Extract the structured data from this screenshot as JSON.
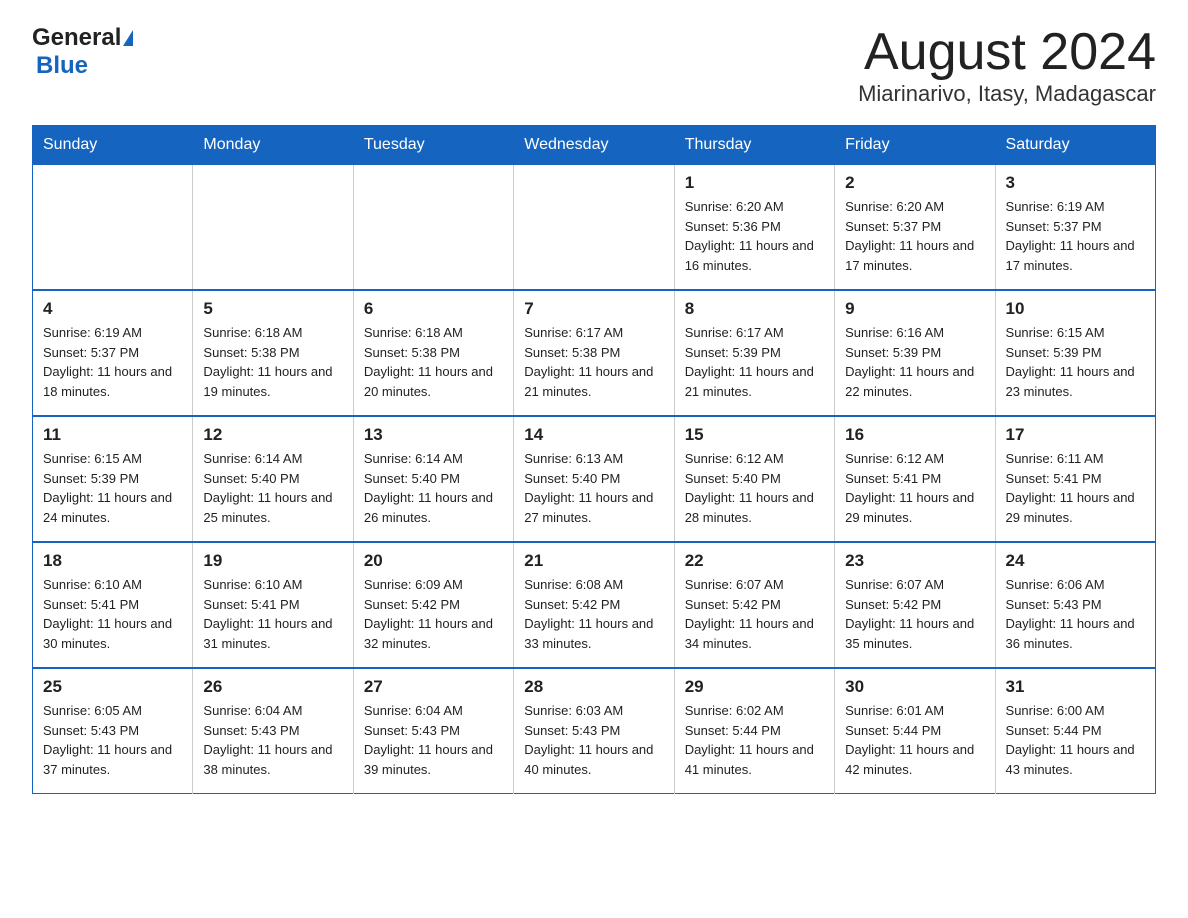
{
  "header": {
    "logo_general": "General",
    "logo_blue": "Blue",
    "month_title": "August 2024",
    "location": "Miarinarivo, Itasy, Madagascar"
  },
  "days_of_week": [
    "Sunday",
    "Monday",
    "Tuesday",
    "Wednesday",
    "Thursday",
    "Friday",
    "Saturday"
  ],
  "weeks": [
    [
      {
        "day": "",
        "info": ""
      },
      {
        "day": "",
        "info": ""
      },
      {
        "day": "",
        "info": ""
      },
      {
        "day": "",
        "info": ""
      },
      {
        "day": "1",
        "info": "Sunrise: 6:20 AM\nSunset: 5:36 PM\nDaylight: 11 hours and 16 minutes."
      },
      {
        "day": "2",
        "info": "Sunrise: 6:20 AM\nSunset: 5:37 PM\nDaylight: 11 hours and 17 minutes."
      },
      {
        "day": "3",
        "info": "Sunrise: 6:19 AM\nSunset: 5:37 PM\nDaylight: 11 hours and 17 minutes."
      }
    ],
    [
      {
        "day": "4",
        "info": "Sunrise: 6:19 AM\nSunset: 5:37 PM\nDaylight: 11 hours and 18 minutes."
      },
      {
        "day": "5",
        "info": "Sunrise: 6:18 AM\nSunset: 5:38 PM\nDaylight: 11 hours and 19 minutes."
      },
      {
        "day": "6",
        "info": "Sunrise: 6:18 AM\nSunset: 5:38 PM\nDaylight: 11 hours and 20 minutes."
      },
      {
        "day": "7",
        "info": "Sunrise: 6:17 AM\nSunset: 5:38 PM\nDaylight: 11 hours and 21 minutes."
      },
      {
        "day": "8",
        "info": "Sunrise: 6:17 AM\nSunset: 5:39 PM\nDaylight: 11 hours and 21 minutes."
      },
      {
        "day": "9",
        "info": "Sunrise: 6:16 AM\nSunset: 5:39 PM\nDaylight: 11 hours and 22 minutes."
      },
      {
        "day": "10",
        "info": "Sunrise: 6:15 AM\nSunset: 5:39 PM\nDaylight: 11 hours and 23 minutes."
      }
    ],
    [
      {
        "day": "11",
        "info": "Sunrise: 6:15 AM\nSunset: 5:39 PM\nDaylight: 11 hours and 24 minutes."
      },
      {
        "day": "12",
        "info": "Sunrise: 6:14 AM\nSunset: 5:40 PM\nDaylight: 11 hours and 25 minutes."
      },
      {
        "day": "13",
        "info": "Sunrise: 6:14 AM\nSunset: 5:40 PM\nDaylight: 11 hours and 26 minutes."
      },
      {
        "day": "14",
        "info": "Sunrise: 6:13 AM\nSunset: 5:40 PM\nDaylight: 11 hours and 27 minutes."
      },
      {
        "day": "15",
        "info": "Sunrise: 6:12 AM\nSunset: 5:40 PM\nDaylight: 11 hours and 28 minutes."
      },
      {
        "day": "16",
        "info": "Sunrise: 6:12 AM\nSunset: 5:41 PM\nDaylight: 11 hours and 29 minutes."
      },
      {
        "day": "17",
        "info": "Sunrise: 6:11 AM\nSunset: 5:41 PM\nDaylight: 11 hours and 29 minutes."
      }
    ],
    [
      {
        "day": "18",
        "info": "Sunrise: 6:10 AM\nSunset: 5:41 PM\nDaylight: 11 hours and 30 minutes."
      },
      {
        "day": "19",
        "info": "Sunrise: 6:10 AM\nSunset: 5:41 PM\nDaylight: 11 hours and 31 minutes."
      },
      {
        "day": "20",
        "info": "Sunrise: 6:09 AM\nSunset: 5:42 PM\nDaylight: 11 hours and 32 minutes."
      },
      {
        "day": "21",
        "info": "Sunrise: 6:08 AM\nSunset: 5:42 PM\nDaylight: 11 hours and 33 minutes."
      },
      {
        "day": "22",
        "info": "Sunrise: 6:07 AM\nSunset: 5:42 PM\nDaylight: 11 hours and 34 minutes."
      },
      {
        "day": "23",
        "info": "Sunrise: 6:07 AM\nSunset: 5:42 PM\nDaylight: 11 hours and 35 minutes."
      },
      {
        "day": "24",
        "info": "Sunrise: 6:06 AM\nSunset: 5:43 PM\nDaylight: 11 hours and 36 minutes."
      }
    ],
    [
      {
        "day": "25",
        "info": "Sunrise: 6:05 AM\nSunset: 5:43 PM\nDaylight: 11 hours and 37 minutes."
      },
      {
        "day": "26",
        "info": "Sunrise: 6:04 AM\nSunset: 5:43 PM\nDaylight: 11 hours and 38 minutes."
      },
      {
        "day": "27",
        "info": "Sunrise: 6:04 AM\nSunset: 5:43 PM\nDaylight: 11 hours and 39 minutes."
      },
      {
        "day": "28",
        "info": "Sunrise: 6:03 AM\nSunset: 5:43 PM\nDaylight: 11 hours and 40 minutes."
      },
      {
        "day": "29",
        "info": "Sunrise: 6:02 AM\nSunset: 5:44 PM\nDaylight: 11 hours and 41 minutes."
      },
      {
        "day": "30",
        "info": "Sunrise: 6:01 AM\nSunset: 5:44 PM\nDaylight: 11 hours and 42 minutes."
      },
      {
        "day": "31",
        "info": "Sunrise: 6:00 AM\nSunset: 5:44 PM\nDaylight: 11 hours and 43 minutes."
      }
    ]
  ]
}
